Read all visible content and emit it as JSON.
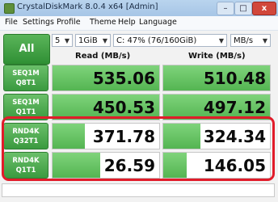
{
  "window": {
    "title": "CrystalDiskMark 8.0.4 x64 [Admin]",
    "close_label": "x"
  },
  "menu": [
    "File",
    "Settings",
    "Profile",
    "Theme",
    "Help",
    "Language"
  ],
  "controls": {
    "all_label": "All",
    "runs": "5",
    "size": "1GiB",
    "drive": "C: 47% (76/160GiB)",
    "units": "MB/s"
  },
  "headers": {
    "read": "Read (MB/s)",
    "write": "Write (MB/s)"
  },
  "rows": [
    {
      "label1": "SEQ1M",
      "label2": "Q8T1",
      "read": "535.06",
      "write": "510.48",
      "read_fill": 1.0,
      "write_fill": 1.0
    },
    {
      "label1": "SEQ1M",
      "label2": "Q1T1",
      "read": "450.53",
      "write": "497.12",
      "read_fill": 1.0,
      "write_fill": 1.0
    },
    {
      "label1": "RND4K",
      "label2": "Q32T1",
      "read": "371.78",
      "write": "324.34",
      "read_fill": 0.3,
      "write_fill": 0.35
    },
    {
      "label1": "RND4K",
      "label2": "Q1T1",
      "read": "26.59",
      "write": "146.05",
      "read_fill": 0.45,
      "write_fill": 0.22
    }
  ],
  "colors": {
    "accent": "#3a9a3f",
    "highlight": "#e11c2a"
  }
}
